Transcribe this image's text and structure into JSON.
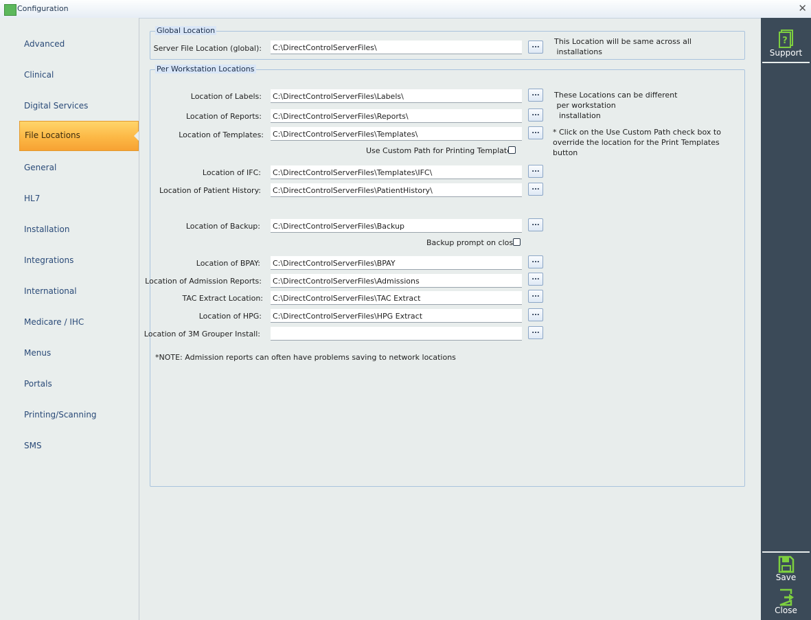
{
  "window": {
    "title": "Configuration"
  },
  "sidebar": {
    "items": [
      {
        "label": "Advanced"
      },
      {
        "label": "Clinical"
      },
      {
        "label": "Digital Services"
      },
      {
        "label": "File Locations"
      },
      {
        "label": "General"
      },
      {
        "label": "HL7"
      },
      {
        "label": "Installation"
      },
      {
        "label": "Integrations"
      },
      {
        "label": "International"
      },
      {
        "label": "Medicare / IHC"
      },
      {
        "label": "Menus"
      },
      {
        "label": "Portals"
      },
      {
        "label": "Printing/Scanning"
      },
      {
        "label": "SMS"
      }
    ],
    "active": "File Locations"
  },
  "global": {
    "title": "Global Location",
    "server_label": "Server File Location (global):",
    "server_value": "C:\\DirectControlServerFiles\\",
    "note": "This Location will be same across all\n installations"
  },
  "workstation": {
    "title": "Per Workstation Locations",
    "labels_label": "Location of Labels:",
    "labels_value": "C:\\DirectControlServerFiles\\Labels\\",
    "reports_label": "Location of Reports:",
    "reports_value": "C:\\DirectControlServerFiles\\Reports\\",
    "templates_label": "Location of Templates:",
    "templates_value": "C:\\DirectControlServerFiles\\Templates\\",
    "custom_path_label": "Use Custom Path for Printing Templates",
    "ifc_label": "Location of IFC:",
    "ifc_value": "C:\\DirectControlServerFiles\\Templates\\IFC\\",
    "history_label": "Location of Patient History:",
    "history_value": "C:\\DirectControlServerFiles\\PatientHistory\\",
    "backup_label": "Location of Backup:",
    "backup_value": "C:\\DirectControlServerFiles\\Backup",
    "backup_prompt_label": "Backup prompt on close",
    "bpay_label": "Location of BPAY:",
    "bpay_value": "C:\\DirectControlServerFiles\\BPAY",
    "admission_label": "Location of Admission Reports:",
    "admission_value": "C:\\DirectControlServerFiles\\Admissions",
    "tac_label": "TAC Extract Location:",
    "tac_value": "C:\\DirectControlServerFiles\\TAC Extract",
    "hpg_label": "Location of HPG:",
    "hpg_value": "C:\\DirectControlServerFiles\\HPG Extract",
    "grouper_label": "Location of 3M Grouper Install:",
    "grouper_value": "",
    "note1": "These Locations can be different\n per workstation\n  installation",
    "note2": "* Click on the Use Custom Path check box to\noverride the location for the Print Templates\nbutton",
    "footnote": "*NOTE: Admission reports can often have problems saving to network locations",
    "browse_label": "..."
  },
  "rightbar": {
    "support_label": "Support",
    "save_label": "Save",
    "close_label": "Close",
    "icon_color": "#7dcf3f"
  }
}
